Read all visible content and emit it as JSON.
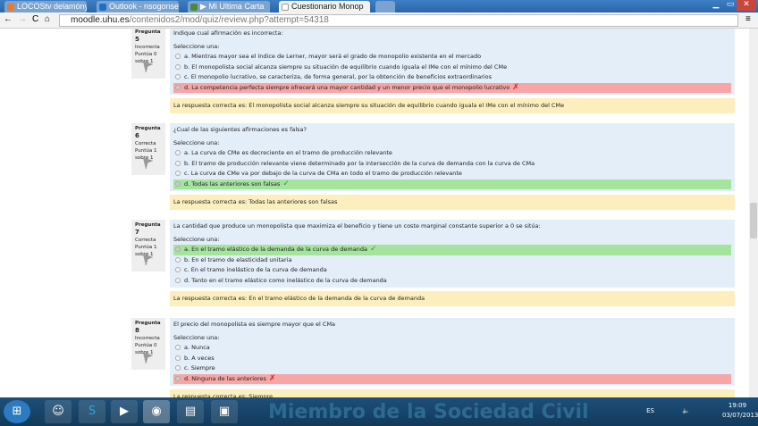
{
  "browser": {
    "tabs": [
      "LOCOStv delamónyC",
      "Outlook - nsogonse_",
      "▶ Mi Ultima Carta",
      "Cuestionario Monop"
    ],
    "url_host": "moodle.uhu.es",
    "url_path": "/contenidos2/mod/quiz/review.php?attempt=54318"
  },
  "questions": [
    {
      "label": "Pregunta",
      "num": "5",
      "state": "Incorrecta",
      "score": "Puntúa 0 sobre 1",
      "text": "Indique cual afirmación es incorrecta:",
      "prompt": "Seleccione una:",
      "options": [
        "a. Mientras mayor sea el índice de Lerner, mayor será el grado de monopolio existente en el mercado",
        "b. El monopolista social alcanza siempre su situación de equilibrio cuando iguala el IMe con el mínimo del CMe",
        "c. El monopolio lucrativo, se caracteriza, de forma general, por la obtención de beneficios extraordinarios",
        "d. La competencia perfecta siempre ofrecerá una mayor cantidad y un menor precio que el monopolio lucrativo"
      ],
      "selected": 3,
      "result": "wrong",
      "feedback": "La respuesta correcta es: El monopolista social alcanza siempre su situación de equilibrio cuando iguala el IMe con el mínimo del CMe"
    },
    {
      "label": "Pregunta",
      "num": "6",
      "state": "Correcta",
      "score": "Puntúa 1 sobre 1",
      "text": "¿Cual de las siguientes afirmaciones es falsa?",
      "prompt": "Seleccione una:",
      "options": [
        "a. La curva de CMe es decreciente en el tramo de producción relevante",
        "b. El tramo de producción relevante viene determinado por la intersección de la curva de demanda con la curva de CMa",
        "c. La curva de CMe va por debajo de la curva de CMa en todo el tramo de producción relevante",
        "d. Todas las anteriores son falsas"
      ],
      "selected": 3,
      "result": "right",
      "feedback": "La respuesta correcta es: Todas las anteriores son falsas"
    },
    {
      "label": "Pregunta",
      "num": "7",
      "state": "Correcta",
      "score": "Puntúa 1 sobre 1",
      "text": "La cantidad que produce un monopolista que maximiza el beneficio y tiene un coste marginal constante superior a 0 se sitúa:",
      "prompt": "Seleccione una:",
      "options": [
        "a. En el tramo elástico de la demanda de la curva de demanda",
        "b. En el tramo de elasticidad unitaria",
        "c. En el tramo inelástico de la curva de demanda",
        "d. Tanto en el tramo elástico como inelástico de la curva de demanda"
      ],
      "selected": 0,
      "result": "right",
      "feedback": "La respuesta correcta es: En el tramo elástico de la demanda de la curva de demanda"
    },
    {
      "label": "Pregunta",
      "num": "8",
      "state": "Incorrecta",
      "score": "Puntúa 0 sobre 1",
      "text": "El precio del monopolista es siempre mayor que el CMa",
      "prompt": "Seleccione una:",
      "options": [
        "a. Nunca",
        "b. A veces",
        "c. Siempre",
        "d. Ninguna de las anteriores"
      ],
      "selected": 3,
      "result": "wrong",
      "feedback": "La respuesta correcta es: Siempre"
    }
  ],
  "taskbar": {
    "watermark": "Miembro de la  Sociedad Civil",
    "lang": "ES",
    "time": "19:09",
    "date": "03/07/2013"
  }
}
